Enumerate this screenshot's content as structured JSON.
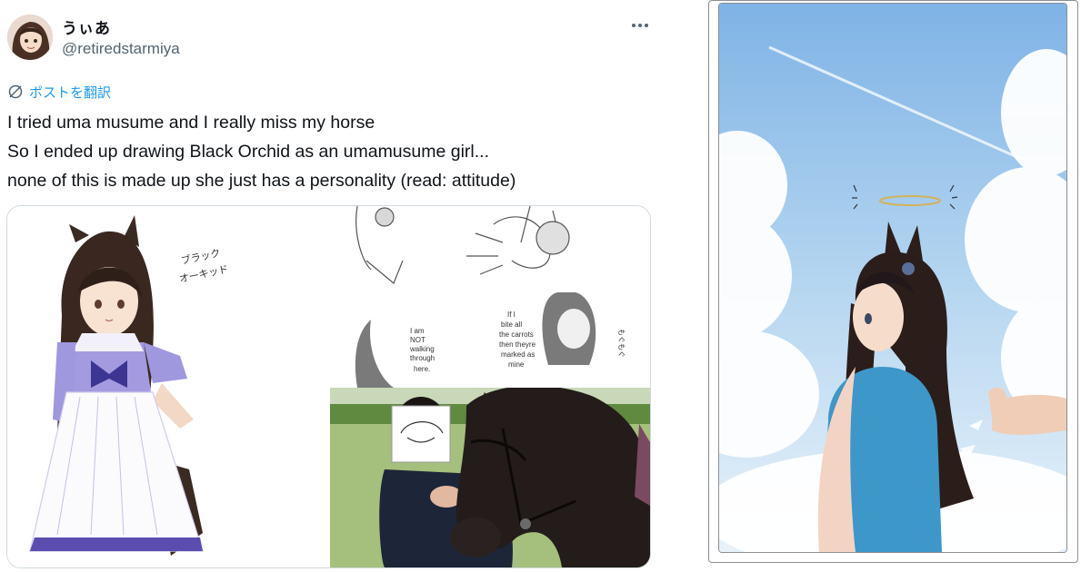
{
  "tweet": {
    "display_name": "うぃあ",
    "handle": "@retiredstarmiya",
    "translate_label": "ポストを翻訳",
    "text_lines": [
      "I tried uma musume and I really miss my horse",
      "So I ended up drawing Black Orchid as an umamusume girl...",
      "none of this is made up she just has a personality (read: attitude)"
    ]
  },
  "media": {
    "sketch_label_1": "ブラック",
    "sketch_label_2": "オーキッド",
    "comic_text_a": [
      "I am",
      "NOT",
      "walking",
      "through",
      "here."
    ],
    "comic_text_b": [
      "If I",
      "bite all",
      "the carrots",
      "then theyre",
      "marked as",
      "mine"
    ],
    "comic_text_c": "もぐもぐ"
  },
  "icons": {
    "more": "more-horizontal-icon",
    "translate": "translate-globe-icon"
  },
  "colors": {
    "accent": "#1d9bf0",
    "secondary_text": "#536471",
    "border": "#cfd9de"
  }
}
